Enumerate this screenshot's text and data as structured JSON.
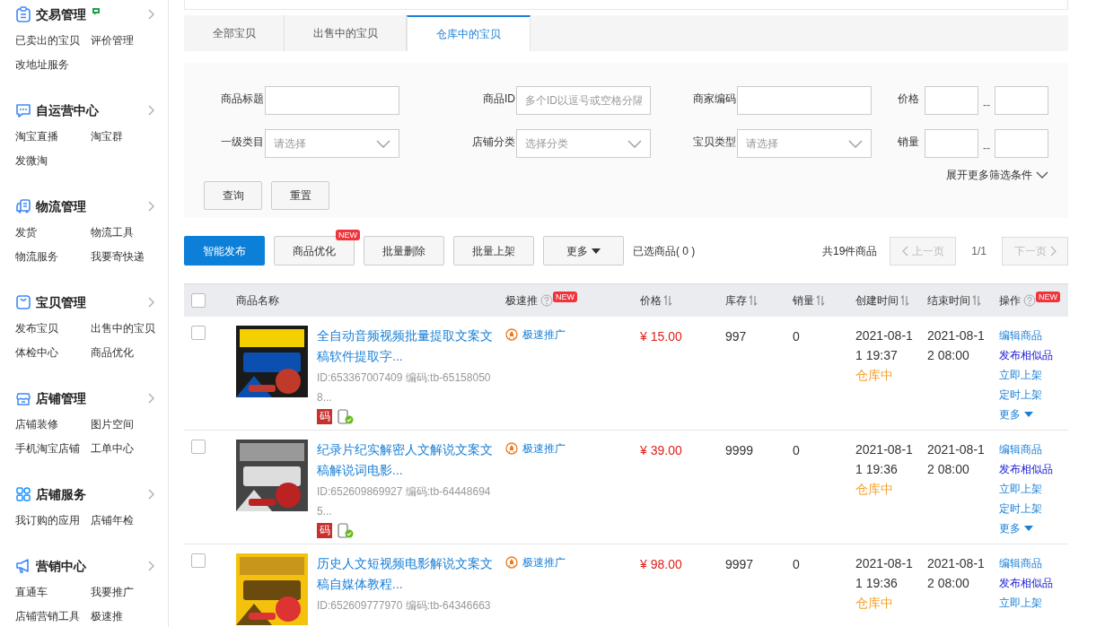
{
  "sidebar": {
    "sections": [
      {
        "kind": "list",
        "title": "交易管理",
        "flag": true,
        "items": [
          "已卖出的宝贝",
          "评价管理",
          "改地址服务"
        ]
      },
      {
        "kind": "chat",
        "title": "自运营中心",
        "flag": false,
        "items": [
          "淘宝直播",
          "淘宝群",
          "发微淘"
        ]
      },
      {
        "kind": "truck",
        "title": "物流管理",
        "flag": false,
        "items": [
          "发货",
          "物流工具",
          "物流服务",
          "我要寄快递"
        ]
      },
      {
        "kind": "bag",
        "title": "宝贝管理",
        "flag": false,
        "items": [
          "发布宝贝",
          "出售中的宝贝",
          "体检中心",
          "商品优化"
        ]
      },
      {
        "kind": "shop",
        "title": "店铺管理",
        "flag": false,
        "items": [
          "店铺装修",
          "图片空间",
          "手机淘宝店铺",
          "工单中心"
        ]
      },
      {
        "kind": "grid",
        "title": "店铺服务",
        "flag": false,
        "items": [
          "我订购的应用",
          "店铺年检"
        ]
      },
      {
        "kind": "megaphone",
        "title": "营销中心",
        "flag": false,
        "items": [
          "直通车",
          "我要推广",
          "店铺营销工具",
          "极速推"
        ]
      }
    ]
  },
  "tabs": [
    {
      "label": "全部宝贝",
      "selected": false
    },
    {
      "label": "出售中的宝贝",
      "selected": false
    },
    {
      "label": "仓库中的宝贝",
      "selected": true
    }
  ],
  "filters": [
    {
      "label": "商品标题",
      "kind": "text"
    },
    {
      "label": "商品ID",
      "kind": "text",
      "placeholder": "多个ID以逗号或空格分隔"
    },
    {
      "label": "商家编码",
      "kind": "text"
    },
    {
      "label": "价格",
      "kind": "range",
      "separator": "--"
    },
    {
      "label": "一级类目",
      "kind": "select",
      "placeholder": "请选择"
    },
    {
      "label": "店铺分类",
      "kind": "select",
      "placeholder": "选择分类"
    },
    {
      "label": "宝贝类型",
      "kind": "select",
      "placeholder": "请选择"
    },
    {
      "label": "销量",
      "kind": "range",
      "separator": "--"
    }
  ],
  "expand_link": "展开更多筛选条件",
  "filter_buttons": [
    "查询",
    "重置"
  ],
  "toolbar": {
    "buttons": [
      {
        "label": "智能发布",
        "kind": "primary"
      },
      {
        "label": "商品优化",
        "kind": "plain",
        "badge": "NEW"
      },
      {
        "label": "批量删除",
        "kind": "plain"
      },
      {
        "label": "批量上架",
        "kind": "plain"
      },
      {
        "label": "更多",
        "kind": "dropdown"
      }
    ],
    "selected_count": "已选商品( 0 )",
    "total": "共19件商品",
    "prev": "上一页",
    "page": "1/1",
    "next": "下一页"
  },
  "table": {
    "header_checked": false,
    "columns": [
      {
        "label": "商品名称",
        "sortable": false,
        "help": false
      },
      {
        "label": "极速推",
        "sortable": false,
        "help": true,
        "badge": "NEW"
      },
      {
        "label": "价格",
        "sortable": true,
        "help": false
      },
      {
        "label": "库存",
        "sortable": true,
        "help": false
      },
      {
        "label": "销量",
        "sortable": true,
        "help": false
      },
      {
        "label": "创建时间",
        "sortable": true,
        "help": false
      },
      {
        "label": "结束时间",
        "sortable": true,
        "help": false
      },
      {
        "label": "操作",
        "sortable": false,
        "help": true,
        "badge": "NEW"
      }
    ],
    "rows": [
      {
        "checked": false,
        "title": "全自动音频视频批量提取文案文稿软件提取字...",
        "id_line": "ID:653367007409 编码:tb-651580508...",
        "code_badge": "码",
        "promo": "极速推广",
        "price": "¥ 15.00",
        "stock": "997",
        "sales": "0",
        "created": "2021-08-11 19:37",
        "ended": "2021-08-12 08:00",
        "status": "仓库中",
        "actions": [
          {
            "label": "编辑商品",
            "kind": "link"
          },
          {
            "label": "发布相似品",
            "kind": "strong"
          },
          {
            "label": "立即上架",
            "kind": "link"
          },
          {
            "label": "定时上架",
            "kind": "link"
          }
        ],
        "more": "更多"
      },
      {
        "checked": false,
        "title": "纪录片纪实解密人文解说文案文稿解说词电影...",
        "id_line": "ID:652609869927 编码:tb-644486945...",
        "code_badge": "码",
        "promo": "极速推广",
        "price": "¥ 39.00",
        "stock": "9999",
        "sales": "0",
        "created": "2021-08-11 19:36",
        "ended": "2021-08-12 08:00",
        "status": "仓库中",
        "actions": [
          {
            "label": "编辑商品",
            "kind": "link"
          },
          {
            "label": "发布相似品",
            "kind": "strong"
          },
          {
            "label": "立即上架",
            "kind": "link"
          },
          {
            "label": "定时上架",
            "kind": "link"
          }
        ],
        "more": "更多"
      },
      {
        "checked": false,
        "title": "历史人文短视频电影解说文案文稿自媒体教程...",
        "id_line": "ID:652609777970 编码:tb-64346663",
        "promo": "极速推广",
        "price": "¥ 98.00",
        "stock": "9997",
        "sales": "0",
        "created": "2021-08-11 19:36",
        "ended": "2021-08-12 08:00",
        "status": "仓库中",
        "actions": [
          {
            "label": "编辑商品",
            "kind": "link"
          },
          {
            "label": "发布相似品",
            "kind": "strong"
          },
          {
            "label": "立即上架",
            "kind": "link"
          }
        ]
      }
    ]
  }
}
